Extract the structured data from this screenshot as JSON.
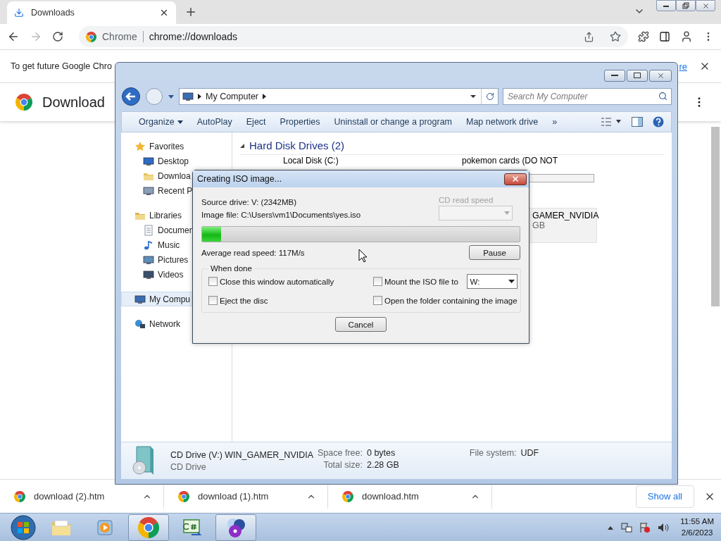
{
  "browser": {
    "tab": {
      "title": "Downloads"
    },
    "omnibox": {
      "site": "Chrome",
      "url": "chrome://downloads"
    },
    "infobar": {
      "text": "To get future Google Chro",
      "link": "re"
    },
    "page_title": "Download"
  },
  "explorer": {
    "address": "My Computer",
    "search": {
      "placeholder": "Search My Computer"
    },
    "toolbar": [
      {
        "label": "Organize",
        "kind": "menu"
      },
      {
        "label": "AutoPlay",
        "kind": "button"
      },
      {
        "label": "Eject",
        "kind": "button"
      },
      {
        "label": "Properties",
        "kind": "button"
      },
      {
        "label": "Uninstall or change a program",
        "kind": "button"
      },
      {
        "label": "Map network drive",
        "kind": "button"
      },
      {
        "label": "»",
        "kind": "overflow"
      }
    ],
    "nav": [
      {
        "label": "Favorites",
        "kind": "star",
        "selected": false,
        "children": [
          {
            "label": "Desktop",
            "kind": "desktop",
            "selected": false
          },
          {
            "label": "Downloa",
            "kind": "folder",
            "selected": false
          },
          {
            "label": "Recent P",
            "kind": "recent",
            "selected": false
          }
        ]
      },
      {
        "label": "Libraries",
        "kind": "library",
        "selected": false,
        "children": [
          {
            "label": "Documen",
            "kind": "document",
            "selected": false
          },
          {
            "label": "Music",
            "kind": "music",
            "selected": false
          },
          {
            "label": "Pictures",
            "kind": "pictures",
            "selected": false
          },
          {
            "label": "Videos",
            "kind": "videos",
            "selected": false
          }
        ]
      },
      {
        "label": "My Compu",
        "kind": "computer",
        "selected": true
      },
      {
        "label": "Network",
        "kind": "network",
        "selected": false
      }
    ],
    "group": {
      "title": "Hard Disk Drives (2)",
      "expanded": true
    },
    "drives": [
      {
        "name": "Local Disk (C:)"
      },
      {
        "name": "pokemon cards (DO NOT"
      }
    ],
    "cd_tile": {
      "name": "GAMER_NVIDIA",
      "size": "GB"
    },
    "details": {
      "title": "CD Drive (V:) WIN_GAMER_NVIDIA",
      "subtitle": "CD Drive",
      "fields": [
        {
          "label": "Space free:",
          "value": "0 bytes"
        },
        {
          "label": "Total size:",
          "value": "2.28 GB"
        },
        {
          "label": "File system:",
          "value": "UDF"
        }
      ]
    }
  },
  "dialog": {
    "title": "Creating ISO image...",
    "source": "Source drive: V: (2342MB)",
    "image_file": "Image file: C:\\Users\\vm1\\Documents\\yes.iso",
    "read_speed_select": {
      "label": "CD read speed",
      "disabled": true
    },
    "progress": {
      "level": 0.06
    },
    "average_speed": "Average read speed: 117M/s",
    "pause": "Pause",
    "when_done": {
      "title": "When done",
      "options": [
        {
          "label": "Close this window automatically",
          "kind": "checkbox",
          "checked": false
        },
        {
          "label": "Mount the ISO file to",
          "kind": "checkbox_select",
          "checked": false,
          "value": "W:"
        },
        {
          "label": "Eject the disc",
          "kind": "checkbox",
          "checked": false
        },
        {
          "label": "Open the folder containing the image",
          "kind": "checkbox",
          "checked": false
        }
      ]
    },
    "cancel": "Cancel"
  },
  "downloads_shelf": {
    "items": [
      {
        "name": "download (2).htm"
      },
      {
        "name": "download (1).htm"
      },
      {
        "name": "download.htm"
      }
    ],
    "show_all": "Show all"
  },
  "taskbar": {
    "apps": [
      {
        "kind": "explorer",
        "active": false
      },
      {
        "kind": "media",
        "active": false
      },
      {
        "kind": "chrome",
        "active": true
      },
      {
        "kind": "csharp",
        "active": false
      },
      {
        "kind": "disc",
        "active": true
      }
    ],
    "time": "11:55 AM",
    "date": "2/6/2023"
  }
}
